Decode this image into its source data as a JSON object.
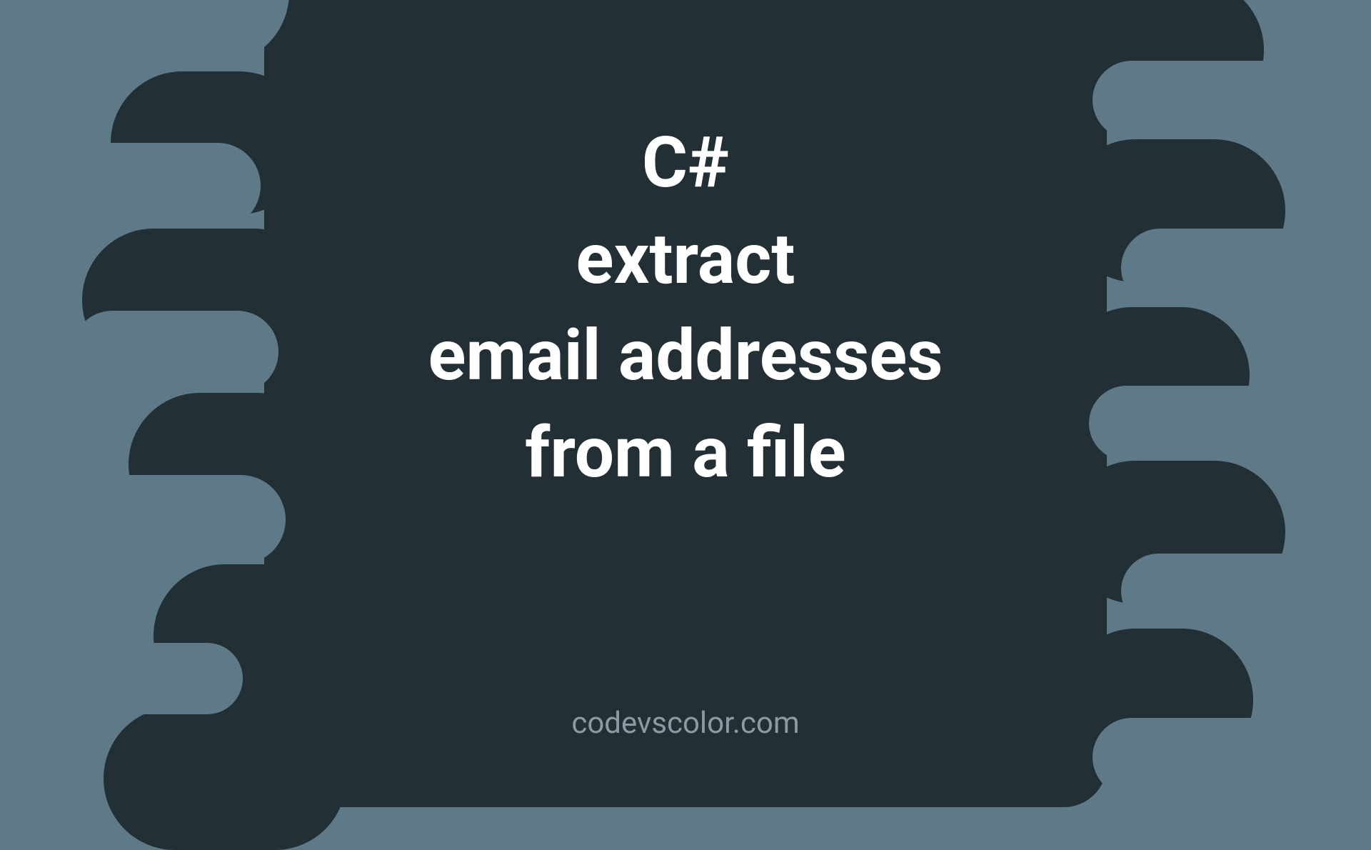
{
  "title": {
    "line1": "C#",
    "line2": "extract",
    "line3": "email addresses",
    "line4": "from a file"
  },
  "watermark": "codevscolor.com"
}
